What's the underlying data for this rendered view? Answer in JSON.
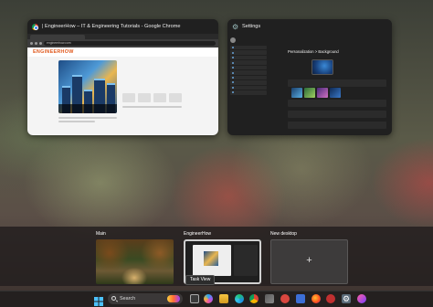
{
  "task_view": {
    "windows": [
      {
        "title": "| EngineerHow – IT & Engineering Tutorials - Google Chrome",
        "app_icon": "chrome-icon"
      },
      {
        "title": "Settings",
        "app_icon": "settings-gear-icon"
      }
    ],
    "chrome_page": {
      "url": "engineerhow.com",
      "logo": "ENGINEERHOW"
    },
    "settings_page": {
      "breadcrumb": "Personalization > Background"
    }
  },
  "desktops": [
    {
      "label": "Main"
    },
    {
      "label": "EngineerHow"
    },
    {
      "label": "New desktop"
    }
  ],
  "tooltip": "Task View",
  "taskbar": {
    "search_label": "Search",
    "icons": [
      "start-icon",
      "search-icon",
      "widgets-icon",
      "task-view-icon",
      "copilot-icon",
      "file-explorer-icon",
      "edge-icon",
      "chrome-icon",
      "store-icon",
      "app-icon",
      "app-icon",
      "firefox-icon",
      "app-icon",
      "settings-icon",
      "app-icon"
    ]
  },
  "colors": {
    "accent": "#0078d4",
    "logo": "#e05a1e"
  }
}
